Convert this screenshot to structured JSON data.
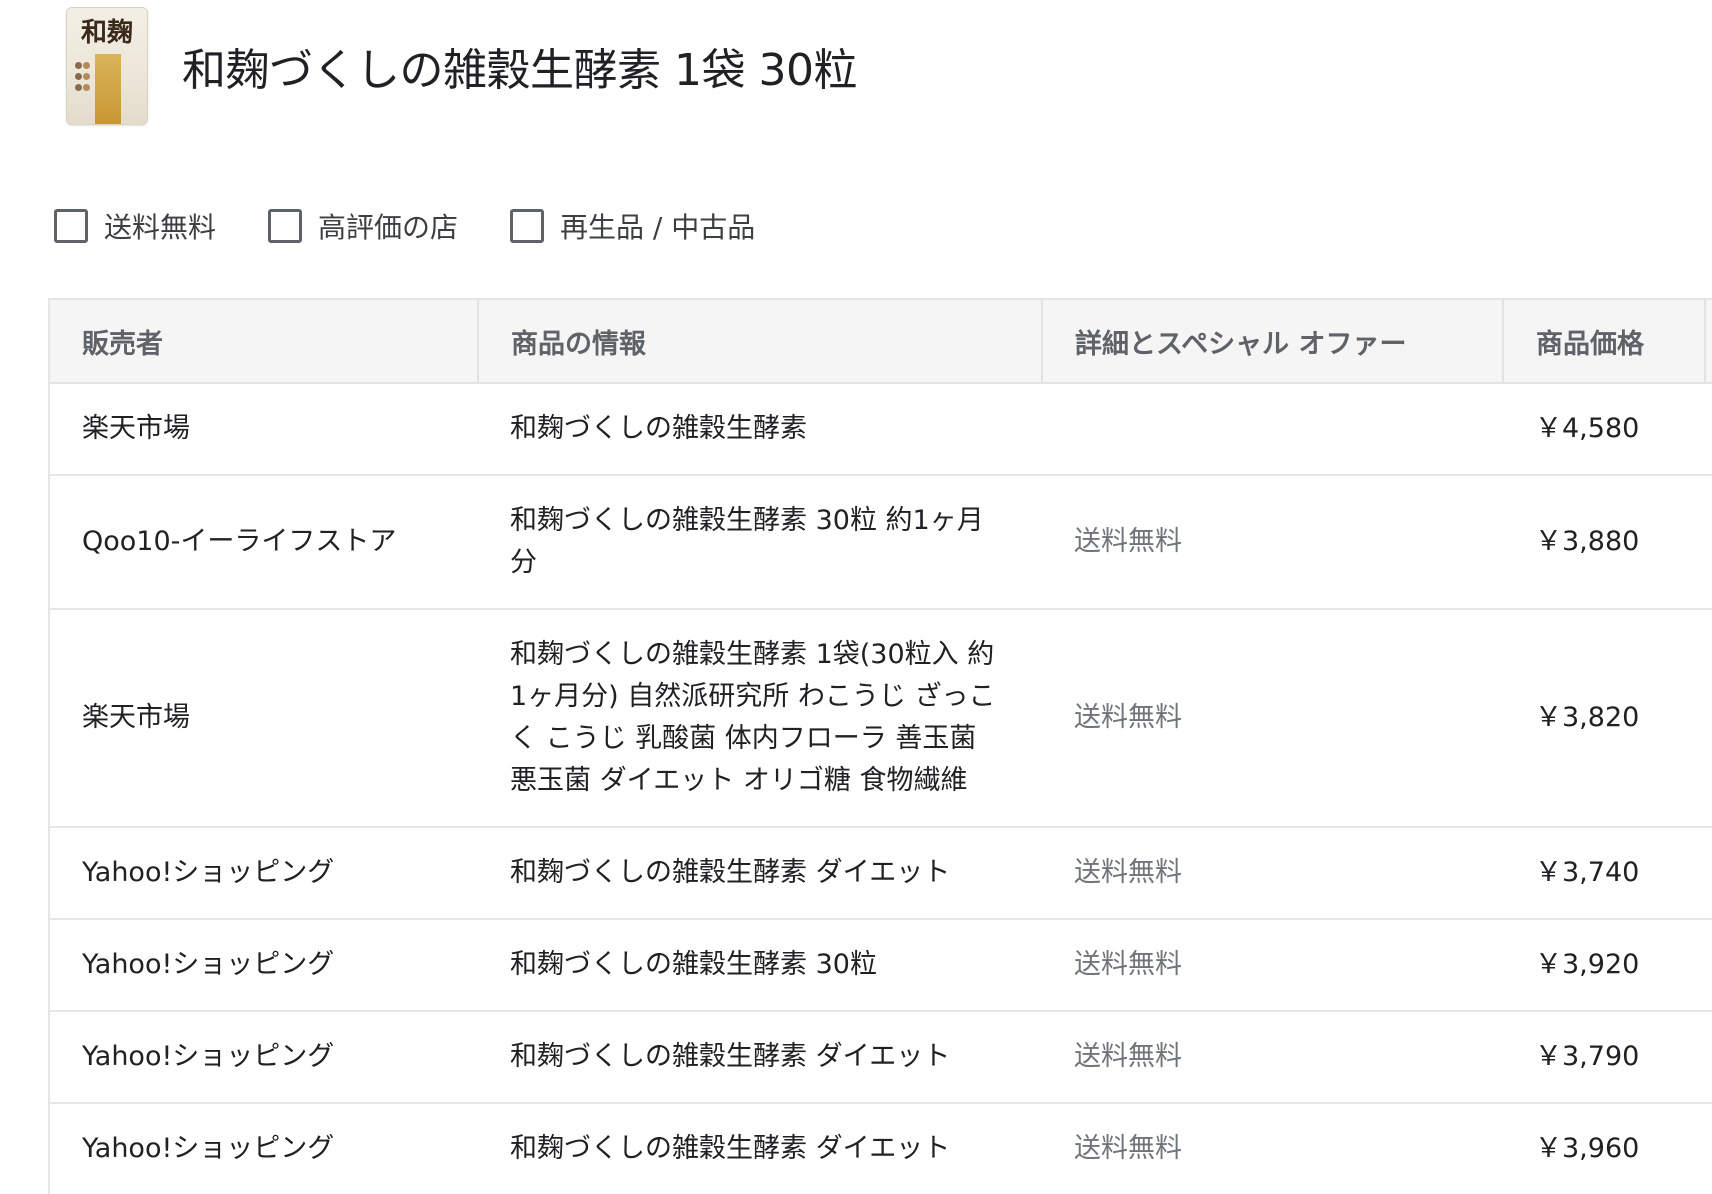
{
  "product": {
    "title": "和麹づくしの雑穀生酵素 1袋 30粒",
    "thumbnail_text": "和麹"
  },
  "filters": [
    {
      "label": "送料無料",
      "checked": false
    },
    {
      "label": "高評価の店",
      "checked": false
    },
    {
      "label": "再生品 / 中古品",
      "checked": false
    }
  ],
  "table": {
    "headers": [
      "販売者",
      "商品の情報",
      "詳細とスペシャル オファー",
      "商品価格"
    ],
    "rows": [
      {
        "seller": "楽天市場",
        "info": "和麹づくしの雑穀生酵素",
        "detail": "",
        "price": "￥4,580"
      },
      {
        "seller": "Qoo10-イーライフストア",
        "info": "和麹づくしの雑穀生酵素 30粒 約1ヶ月分",
        "detail": "送料無料",
        "price": "￥3,880"
      },
      {
        "seller": "楽天市場",
        "info": "和麹づくしの雑穀生酵素 1袋(30粒入 約1ヶ月分) 自然派研究所 わこうじ ざっこく こうじ 乳酸菌 体内フローラ 善玉菌 悪玉菌 ダイエット オリゴ糖 食物繊維",
        "detail": "送料無料",
        "price": "￥3,820"
      },
      {
        "seller": "Yahoo!ショッピング",
        "info": "和麹づくしの雑穀生酵素 ダイエット",
        "detail": "送料無料",
        "price": "￥3,740"
      },
      {
        "seller": "Yahoo!ショッピング",
        "info": "和麹づくしの雑穀生酵素 30粒",
        "detail": "送料無料",
        "price": "￥3,920"
      },
      {
        "seller": "Yahoo!ショッピング",
        "info": "和麹づくしの雑穀生酵素 ダイエット",
        "detail": "送料無料",
        "price": "￥3,790"
      },
      {
        "seller": "Yahoo!ショッピング",
        "info": "和麹づくしの雑穀生酵素 ダイエット",
        "detail": "送料無料",
        "price": "￥3,960"
      }
    ]
  }
}
